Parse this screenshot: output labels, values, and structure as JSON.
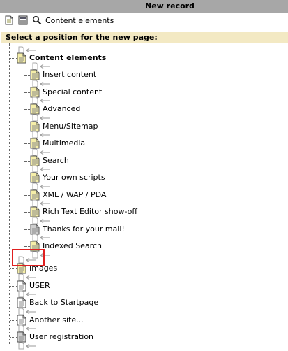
{
  "window": {
    "title": "New record"
  },
  "toolbar": {
    "label": "Content elements",
    "icons": [
      "page-icon",
      "list-icon",
      "search-icon"
    ]
  },
  "header": {
    "text": "Select a position for the new page:"
  },
  "tree": {
    "root": "Content elements",
    "children": [
      "Insert content",
      "Special content",
      "Advanced",
      "Menu/Sitemap",
      "Multimedia",
      "Search",
      "Your own scripts",
      "XML / WAP / PDA",
      "Rich Text Editor show-off",
      "Thanks for your mail!",
      "Indexed Search"
    ],
    "siblings": [
      "Images",
      "USER",
      "Back to Startpage",
      "Another site...",
      "User registration"
    ]
  },
  "colors": {
    "titlebar": "#a7a7a7",
    "header": "#f3e9c3",
    "highlight": "#e02020"
  }
}
